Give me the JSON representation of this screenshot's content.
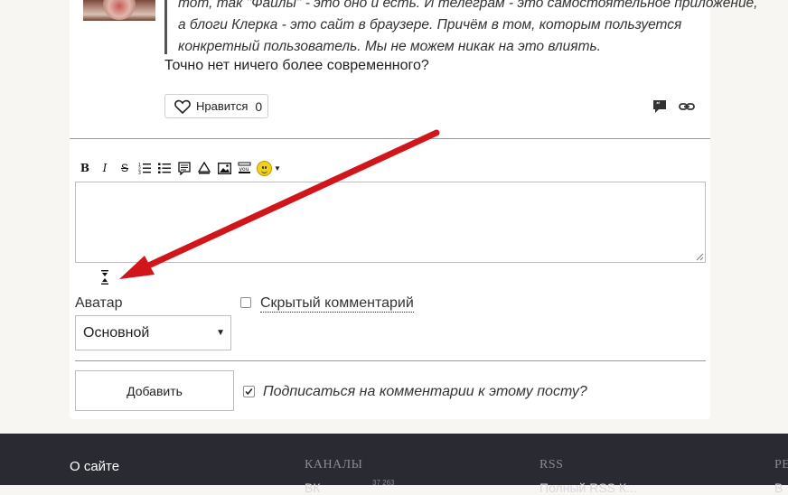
{
  "comment": {
    "quote_lines": [
      "тот, так \"Файлы\" - это оно и есть. И телеграм - это самостоятельное приложение,",
      "а блоги Клерка - это сайт в браузере. Причём в том, которым пользуется",
      "конкретный пользователь. Мы не можем никак на это влиять."
    ],
    "text": "Точно нет ничего более современного?",
    "like_label": "Нравится",
    "like_count": "0"
  },
  "editor": {
    "toolbar": {
      "bold": "B",
      "italic": "I",
      "strike": "S"
    },
    "textarea_value": ""
  },
  "form": {
    "avatar_label": "Аватар",
    "avatar_selected": "Основной",
    "hidden_comment_label": "Скрытый комментарий",
    "hidden_comment_checked": false,
    "add_button": "Добавить",
    "subscribe_label": "Подписаться на комментарии к этому посту?",
    "subscribe_checked": true
  },
  "footer": {
    "about": "О сайте",
    "channels": "КАНАЛЫ",
    "channel_first": "ВК",
    "channel_first_count": "37 263",
    "rss": "RSS",
    "rss_first": "Полный RSS К...",
    "col4_partial": "РЕ",
    "col4_sub": "В"
  },
  "colors": {
    "annotation_arrow": "#d0161b",
    "footer_bg": "#2a2a33"
  }
}
